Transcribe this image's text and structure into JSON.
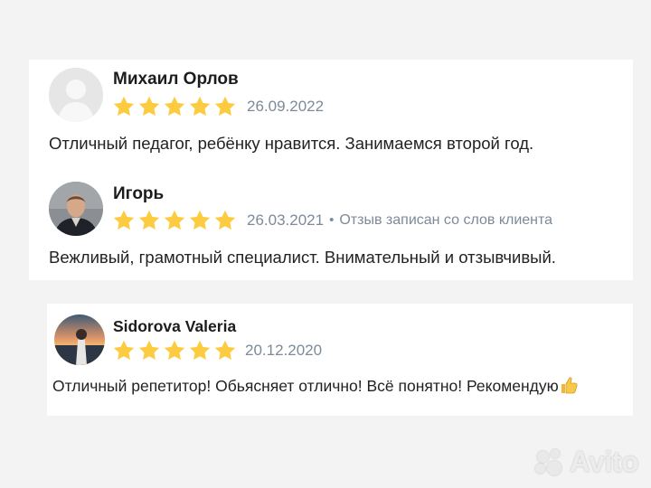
{
  "reviews": [
    {
      "name": "Михаил Орлов",
      "rating": 5,
      "date": "26.09.2022",
      "text": "Отличный педагог, ребёнку нравится. Занимаемся второй год."
    },
    {
      "name": "Игорь",
      "rating": 5,
      "date": "26.03.2021",
      "separator": "•",
      "note": "Отзыв записан со слов клиента",
      "text": "Вежливый, грамотный специалист. Внимательный и отзывчивый."
    },
    {
      "name": "Sidorova Valeria",
      "rating": 5,
      "date": "20.12.2020",
      "text": "Отличный репетитор! Обьясняет отлично! Всё понятно! Рекомендую"
    }
  ],
  "watermark": {
    "text": "Avito"
  },
  "colors": {
    "star": "#fdcb3f",
    "date": "#7c8a9a"
  }
}
